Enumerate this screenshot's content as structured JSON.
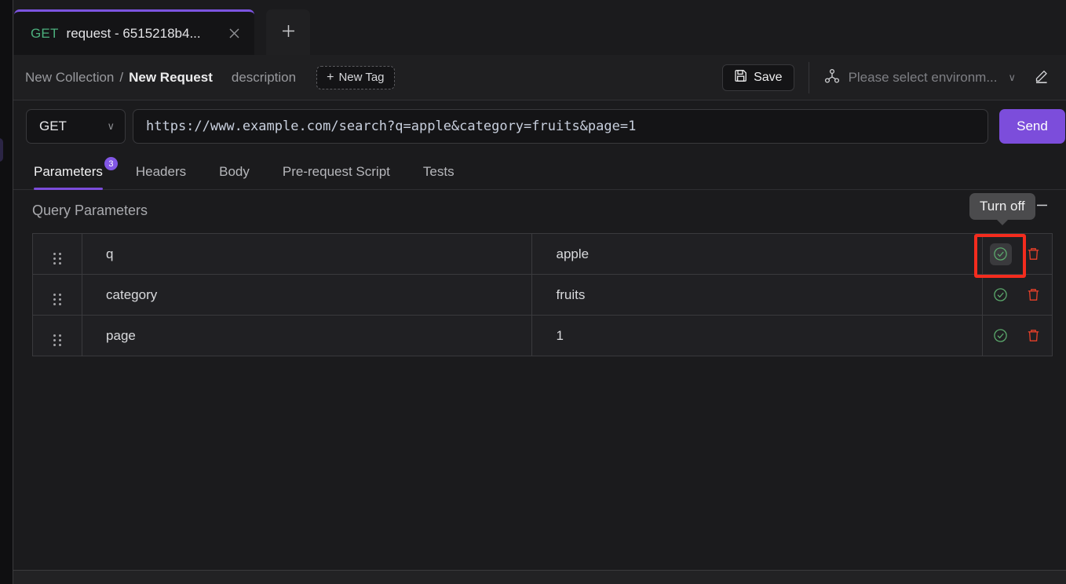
{
  "window": {
    "tab": {
      "method": "GET",
      "title": "request - 6515218b4...",
      "close_icon": "close-icon",
      "new_tab_icon": "plus-icon"
    }
  },
  "header": {
    "breadcrumb": {
      "collection": "New Collection",
      "separator": "/",
      "request": "New Request"
    },
    "description_placeholder": "description",
    "new_tag_label": "New Tag",
    "new_tag_plus": "+",
    "save_label": "Save",
    "environment_placeholder": "Please select environm...",
    "environment_caret": "∨",
    "edit_icon": "pencil-icon"
  },
  "request": {
    "method": "GET",
    "method_caret": "∨",
    "url": "https://www.example.com/search?q=apple&category=fruits&page=1",
    "send_label": "Send"
  },
  "tabs": [
    {
      "label": "Parameters",
      "active": true,
      "badge": "3"
    },
    {
      "label": "Headers",
      "active": false
    },
    {
      "label": "Body",
      "active": false
    },
    {
      "label": "Pre-request Script",
      "active": false
    },
    {
      "label": "Tests",
      "active": false
    }
  ],
  "parameters_section": {
    "title": "Query Parameters",
    "copy_icon": "copy-icon",
    "collapse_icon": "minus-icon",
    "tooltip": "Turn off",
    "rows": [
      {
        "handle": "drag-handle-icon",
        "key": "q",
        "value": "apple",
        "enabled_icon": "check-circle-icon",
        "delete_icon": "trash-icon",
        "highlighted": true
      },
      {
        "handle": "drag-handle-icon",
        "key": "category",
        "value": "fruits",
        "enabled_icon": "check-circle-icon",
        "delete_icon": "trash-icon",
        "highlighted": false
      },
      {
        "handle": "drag-handle-icon",
        "key": "page",
        "value": "1",
        "enabled_icon": "check-circle-icon",
        "delete_icon": "trash-icon",
        "highlighted": false
      }
    ]
  },
  "colors": {
    "accent_purple": "#7c4ddb",
    "method_green": "#4caf7d",
    "enabled_green": "#4c9a5e",
    "delete_red": "#e8402a",
    "highlight_red": "#f42c1e",
    "background": "#1b1b1d"
  }
}
